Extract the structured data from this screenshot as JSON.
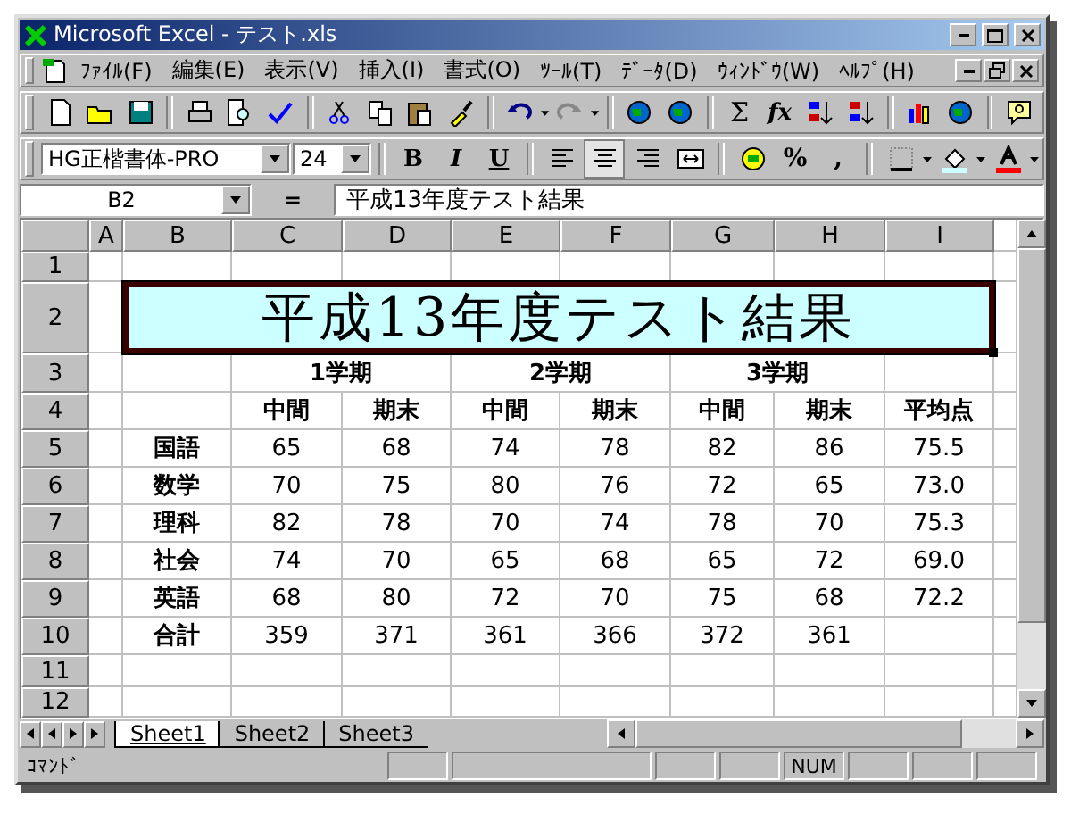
{
  "window": {
    "title": "Microsoft Excel - テスト.xls"
  },
  "menu": [
    "ﾌｧｲﾙ(F)",
    "編集(E)",
    "表示(V)",
    "挿入(I)",
    "書式(O)",
    "ﾂｰﾙ(T)",
    "ﾃﾞｰﾀ(D)",
    "ｳｨﾝﾄﾞｳ(W)",
    "ﾍﾙﾌﾟ(H)"
  ],
  "formatting": {
    "font": "HG正楷書体-PRO",
    "size": "24",
    "style_buttons": [
      {
        "label": "B",
        "kind": "bold"
      },
      {
        "label": "I",
        "kind": "italic"
      },
      {
        "label": "U",
        "kind": "underline"
      }
    ],
    "alignment": [
      {
        "kind": "left",
        "selected": false
      },
      {
        "kind": "center",
        "selected": true
      },
      {
        "kind": "right",
        "selected": false
      }
    ],
    "number_buttons": [
      "%",
      ","
    ]
  },
  "standard": {
    "sum": "Σ",
    "function": "fx"
  },
  "formula_bar": {
    "name_box": "B2",
    "equals": "=",
    "content": "平成13年度テスト結果"
  },
  "sheet": {
    "columns": [
      "A",
      "B",
      "C",
      "D",
      "E",
      "F",
      "G",
      "H",
      "I"
    ],
    "rows": [
      {
        "number": "1",
        "kind": "blank"
      },
      {
        "number": "2",
        "kind": "title",
        "title": "平成13年度テスト結果",
        "selected": true
      },
      {
        "number": "3",
        "kind": "periods",
        "periods": [
          "1学期",
          "2学期",
          "3学期"
        ]
      },
      {
        "number": "4",
        "kind": "header",
        "cells": [
          null,
          null,
          "中間",
          "期末",
          "中間",
          "期末",
          "中間",
          "期末",
          "平均点"
        ]
      },
      {
        "number": "5",
        "kind": "data",
        "cells": [
          null,
          "国語",
          "65",
          "68",
          "74",
          "78",
          "82",
          "86",
          "75.5"
        ]
      },
      {
        "number": "6",
        "kind": "data",
        "cells": [
          null,
          "数学",
          "70",
          "75",
          "80",
          "76",
          "72",
          "65",
          "73.0"
        ]
      },
      {
        "number": "7",
        "kind": "data",
        "cells": [
          null,
          "理科",
          "82",
          "78",
          "70",
          "74",
          "78",
          "70",
          "75.3"
        ]
      },
      {
        "number": "8",
        "kind": "data",
        "cells": [
          null,
          "社会",
          "74",
          "70",
          "65",
          "68",
          "65",
          "72",
          "69.0"
        ]
      },
      {
        "number": "9",
        "kind": "data",
        "cells": [
          null,
          "英語",
          "68",
          "80",
          "72",
          "70",
          "75",
          "68",
          "72.2"
        ]
      },
      {
        "number": "10",
        "kind": "data",
        "cells": [
          null,
          "合計",
          "359",
          "371",
          "361",
          "366",
          "372",
          "361",
          null
        ]
      },
      {
        "number": "11",
        "kind": "blank"
      },
      {
        "number": "12",
        "kind": "blank"
      }
    ]
  },
  "sheet_tabs": [
    {
      "label": "Sheet1",
      "selected": true
    },
    {
      "label": "Sheet2",
      "selected": false
    },
    {
      "label": "Sheet3",
      "selected": false
    }
  ],
  "status_bar": {
    "text": "ｺﾏﾝﾄﾞ",
    "num_indicator": "NUM"
  }
}
